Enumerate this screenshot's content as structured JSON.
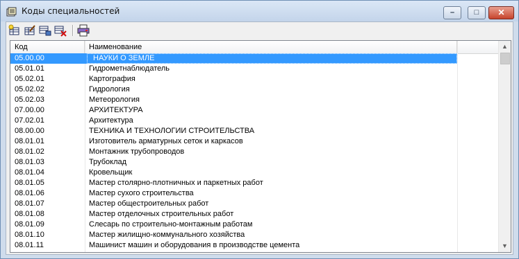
{
  "window": {
    "title": "Коды специальностей"
  },
  "titlebar": {
    "minimize": "–",
    "maximize": "□",
    "close": "✕"
  },
  "toolbar": {
    "buttons": [
      {
        "icon": "add-record-icon"
      },
      {
        "icon": "edit-record-icon"
      },
      {
        "icon": "copy-record-icon"
      },
      {
        "icon": "delete-record-icon"
      },
      {
        "icon": "print-icon"
      }
    ]
  },
  "table": {
    "columns": [
      "Код",
      "Наименование"
    ],
    "rows": [
      {
        "code": "05.00.00",
        "name": "НАУКИ О ЗЕМЛЕ"
      },
      {
        "code": "05.01.01",
        "name": "Гидрометнаблюдатель"
      },
      {
        "code": "05.02.01",
        "name": "Картография"
      },
      {
        "code": "05.02.02",
        "name": "Гидрология"
      },
      {
        "code": "05.02.03",
        "name": "Метеорология"
      },
      {
        "code": "07.00.00",
        "name": "АРХИТЕКТУРА"
      },
      {
        "code": "07.02.01",
        "name": "Архитектура"
      },
      {
        "code": "08.00.00",
        "name": "ТЕХНИКА И ТЕХНОЛОГИИ СТРОИТЕЛЬСТВА"
      },
      {
        "code": "08.01.01",
        "name": "Изготовитель арматурных сеток и каркасов"
      },
      {
        "code": "08.01.02",
        "name": "Монтажник трубопроводов"
      },
      {
        "code": "08.01.03",
        "name": "Трубоклад"
      },
      {
        "code": "08.01.04",
        "name": "Кровельщик"
      },
      {
        "code": "08.01.05",
        "name": "Мастер столярно-плотничных и паркетных работ"
      },
      {
        "code": "08.01.06",
        "name": "Мастер сухого строительства"
      },
      {
        "code": "08.01.07",
        "name": "Мастер общестроительных работ"
      },
      {
        "code": "08.01.08",
        "name": "Мастер отделочных строительных работ"
      },
      {
        "code": "08.01.09",
        "name": "Слесарь по строительно-монтажным работам"
      },
      {
        "code": "08.01.10",
        "name": "Мастер жилищно-коммунального хозяйства"
      },
      {
        "code": "08.01.11",
        "name": "Машинист машин и оборудования в производстве цемента"
      }
    ],
    "selected_row": 0
  },
  "colors": {
    "selection": "#3399ff",
    "titlebar": "#c3d4ea",
    "close": "#c7432c"
  }
}
